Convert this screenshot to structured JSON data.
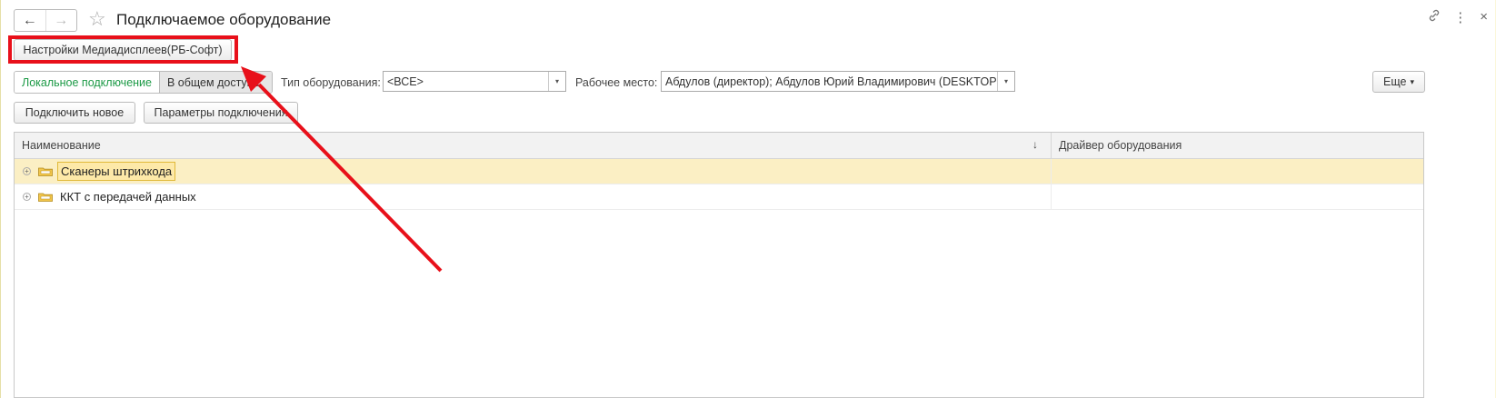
{
  "window": {
    "title": "Подключаемое оборудование",
    "nav_back_label": "←",
    "nav_forward_label": "→",
    "star_label": "☆",
    "link_icon_label": "🔗",
    "more_icon_label": "⋮",
    "close_icon_label": "×"
  },
  "toolbar": {
    "media_settings_label": "Настройки Медиадисплеев(РБ-Софт)",
    "connect_new_label": "Подключить новое",
    "connection_params_label": "Параметры подключения",
    "more_label": "Еще",
    "more_arrow": "▾"
  },
  "filters": {
    "local_label": "Локальное подключение",
    "shared_label": "В общем доступе",
    "equipment_type_label": "Тип оборудования:",
    "equipment_type_value": "<ВСЕ>",
    "workplace_label": "Рабочее место:",
    "workplace_value": "Абдулов (директор); Абдулов Юрий Владимирович (DESKTOP-",
    "dropdown_arrow": "▾"
  },
  "table": {
    "columns": [
      "Наименование",
      "Драйвер оборудования"
    ],
    "sort_indicator": "↓",
    "rows": [
      {
        "name": "Сканеры штрихкода",
        "driver": "",
        "selected": true
      },
      {
        "name": "ККТ с передачей данных",
        "driver": "",
        "selected": false
      }
    ],
    "expander_symbol": "+"
  },
  "icons": {
    "folder": "folder-icon",
    "annotation": "red-arrow-annotation"
  },
  "colors": {
    "highlight": "#e8101a",
    "active_toggle_text": "#1c9a46",
    "selected_row": "#fbefc4"
  }
}
